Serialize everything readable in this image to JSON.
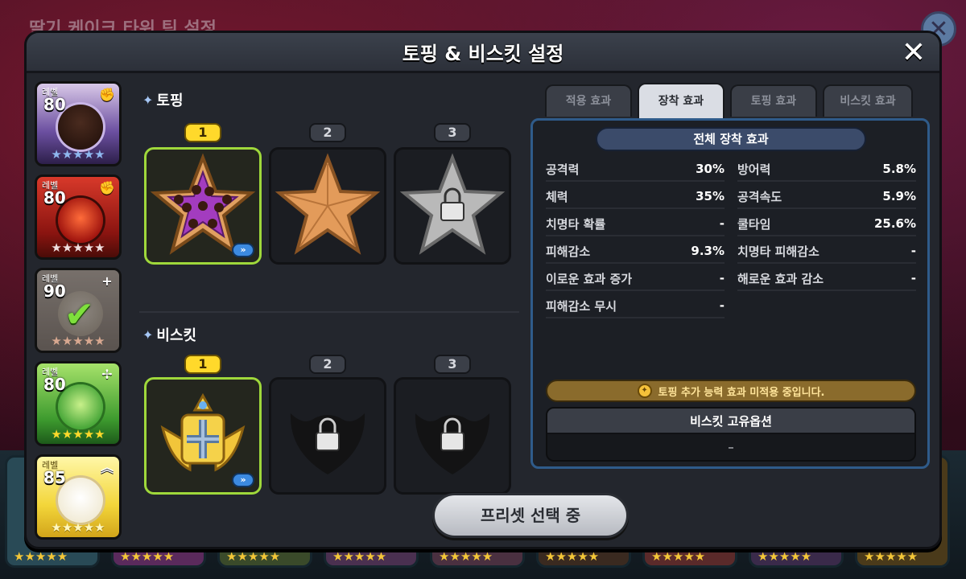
{
  "background": {
    "title": "딸기 케이크 타워 팀 설정"
  },
  "modal": {
    "title": "토핑 & 비스킷 설정",
    "close": "✕"
  },
  "cookies": [
    {
      "level_label": "레벨",
      "level": "80",
      "role": "✊",
      "stars": "★★★★★"
    },
    {
      "level_label": "레벨",
      "level": "80",
      "role": "✊",
      "stars": "★★★★★"
    },
    {
      "level_label": "레벨",
      "level": "90",
      "role": "+",
      "stars": "★★★★★",
      "selected": "✔"
    },
    {
      "level_label": "레벨",
      "level": "80",
      "role": "✢",
      "stars": "★★★★★"
    },
    {
      "level_label": "레벨",
      "level": "85",
      "role": "︽",
      "stars": "★★★★★"
    }
  ],
  "toppings": {
    "title": "토핑",
    "slots": [
      {
        "num": "1",
        "state": "equipped",
        "more": "»"
      },
      {
        "num": "2",
        "state": "empty"
      },
      {
        "num": "3",
        "state": "locked"
      }
    ]
  },
  "biscuits": {
    "title": "비스킷",
    "slots": [
      {
        "num": "1",
        "state": "equipped",
        "more": "»"
      },
      {
        "num": "2",
        "state": "locked"
      },
      {
        "num": "3",
        "state": "locked"
      }
    ]
  },
  "tabs": [
    {
      "label": "적용 효과",
      "active": false
    },
    {
      "label": "장착 효과",
      "active": true
    },
    {
      "label": "토핑 효과",
      "active": false
    },
    {
      "label": "비스킷 효과",
      "active": false
    }
  ],
  "effects": {
    "header": "전체 장착 효과",
    "left": [
      {
        "name": "공격력",
        "value": "30%"
      },
      {
        "name": "체력",
        "value": "35%"
      },
      {
        "name": "치명타 확률",
        "value": "-"
      },
      {
        "name": "피해감소",
        "value": "9.3%"
      },
      {
        "name": "이로운 효과 증가",
        "value": "-"
      },
      {
        "name": "피해감소 무시",
        "value": "-"
      }
    ],
    "right": [
      {
        "name": "방어력",
        "value": "5.8%"
      },
      {
        "name": "공격속도",
        "value": "5.9%"
      },
      {
        "name": "쿨타임",
        "value": "25.6%"
      },
      {
        "name": "치명타 피해감소",
        "value": "-"
      },
      {
        "name": "해로운 효과 감소",
        "value": "-"
      }
    ],
    "notice": "토핑 추가 능력 효과 미적용 중입니다.",
    "unique_title": "비스킷 고유옵션",
    "unique_value": "–"
  },
  "preset_button": "프리셋 선택 중",
  "colors": {
    "accent_active": "#9fd83b",
    "slot_active_num": "#ffd92b",
    "panel_border": "#2f5b8a"
  }
}
